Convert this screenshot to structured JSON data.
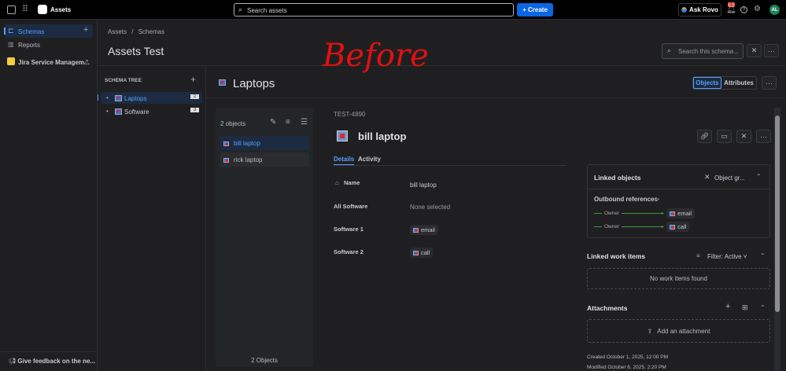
{
  "topbar": {
    "app_name": "Assets",
    "search_placeholder": "Search assets",
    "create_label": "+ Create",
    "ask_rovo": "Ask Rovo",
    "notification_count": "1",
    "avatar": "AL"
  },
  "sidebar": {
    "items": [
      {
        "label": "Schemas"
      },
      {
        "label": "Reports"
      },
      {
        "label": "Jira Service Managem..."
      }
    ],
    "feedback": "Give feedback on the ne..."
  },
  "header": {
    "breadcrumb": [
      "Assets",
      "/",
      "Schemas"
    ],
    "title": "Assets Test",
    "search_placeholder": "Search this schema..."
  },
  "schema_tree": {
    "title": "SCHEMA TREE",
    "items": [
      {
        "label": "Laptops",
        "count": "2"
      },
      {
        "label": "Software",
        "count": "3"
      }
    ]
  },
  "object_type": {
    "title": "Laptops",
    "view_objects": "Objects",
    "view_attributes": "Attributes"
  },
  "object_list": {
    "count_label": "2 objects",
    "items": [
      "bill laptop",
      "rick laptop"
    ],
    "footer": "2 Objects"
  },
  "detail": {
    "key": "TEST-4890",
    "name": "bill laptop",
    "tabs": [
      "Details",
      "Activity"
    ],
    "rows": [
      {
        "label": "Name",
        "value": "bill laptop"
      },
      {
        "label": "All Software",
        "value": "None selected"
      },
      {
        "label": "Software 1",
        "value": "email"
      },
      {
        "label": "Software 2",
        "value": "call"
      }
    ]
  },
  "linked_objects": {
    "title": "Linked objects",
    "graph_label": "Object gr...",
    "outbound": "Outbound references",
    "refs": [
      {
        "relation": "Owner",
        "target": "email"
      },
      {
        "relation": "Owner",
        "target": "call"
      }
    ]
  },
  "work_items": {
    "title": "Linked work items",
    "filter": "Filter: Active",
    "empty": "No work items found"
  },
  "attachments": {
    "title": "Attachments",
    "add": "Add an attachment"
  },
  "meta": {
    "created": "Created October 1, 2025, 12:00 PM",
    "modified": "Modified October 6, 2025, 2:20 PM"
  },
  "annotation": {
    "text": "Before",
    "color": "#e01010"
  },
  "colors": {
    "accent": "#579dff",
    "selected_bg": "#1c2b41",
    "create_bg": "#0c66e4"
  }
}
